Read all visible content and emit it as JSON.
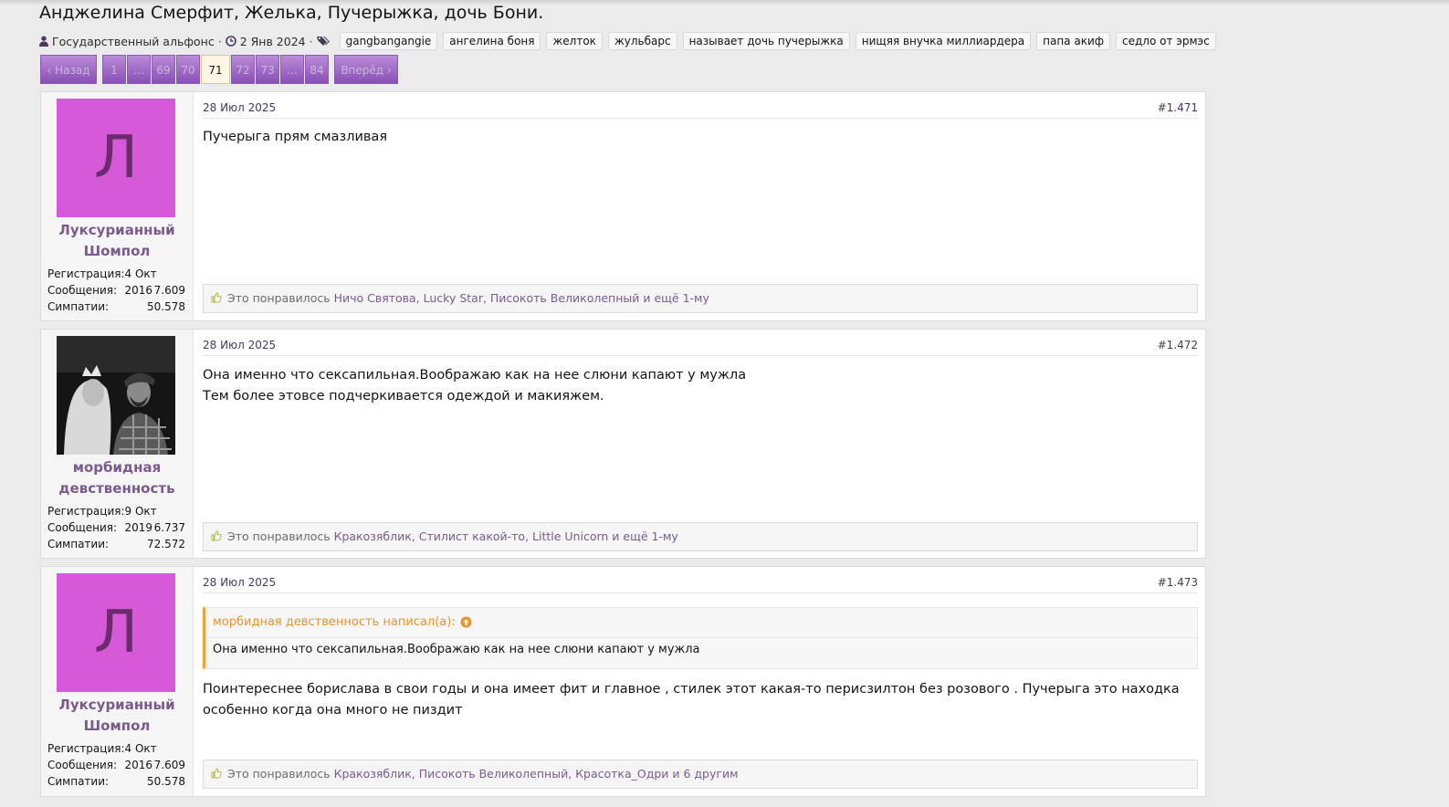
{
  "thread": {
    "title": "Анджелина Смерфит, Желька, Пучерыжка, дочь Бони.",
    "author": "Государственный альфонс",
    "date": "2 Янв 2024",
    "tags": [
      "gangbangangie",
      "ангелина боня",
      "желток",
      "жульбарс",
      "называет дочь пучерыжка",
      "нищяя внучка миллиардера",
      "папа акиф",
      "седло от эрмэс"
    ]
  },
  "pager": {
    "prev": "‹ Назад",
    "pages": [
      "1",
      "…",
      "69",
      "70",
      "71",
      "72",
      "73",
      "…",
      "84"
    ],
    "current": "71",
    "next": "Вперёд ›"
  },
  "stat_labels": {
    "reg": "Регистрация:",
    "msgs": "Сообщения:",
    "likes": "Симпатии:"
  },
  "likes_prefix": "Это понравилось",
  "posts": [
    {
      "avatar_letter": "Л",
      "username": "Луксурианный Шомпол",
      "reg": "4 Окт 2016",
      "msgs": "7.609",
      "likes_count": "50.578",
      "date": "28 Июл 2025",
      "num": "#1.471",
      "text": "Пучерыга прям смазливая",
      "liked_by": "Ничо Святова, Lucky Star, Писокоть Великолепный",
      "liked_more": "и ещё 1-му"
    },
    {
      "avatar_letter": "",
      "username": "морбидная девственность",
      "reg": "9 Окт 2019",
      "msgs": "6.737",
      "likes_count": "72.572",
      "date": "28 Июл 2025",
      "num": "#1.472",
      "text_line1": "Она именно что сексапильная.Воображаю как на нее слюни капают у мужла",
      "text_line2": "Тем более этовсе подчеркивается одеждой и макияжем.",
      "liked_by": "Кракозяблик, Стилист какой-то, Little Unicorn",
      "liked_more": "и ещё 1-му"
    },
    {
      "avatar_letter": "Л",
      "username": "Луксурианный Шомпол",
      "reg": "4 Окт 2016",
      "msgs": "7.609",
      "likes_count": "50.578",
      "date": "28 Июл 2025",
      "num": "#1.473",
      "quote_author": "морбидная девственность написал(а):",
      "quote_text": "Она именно что сексапильная.Воображаю как на нее слюни капают у мужла",
      "text_line1": "Поинтереснее борислава в свои годы и она имеет фит и главное , стилек этот какая-то перисзилтон без розового . Пучерыга это находка",
      "text_line2": "особенно когда она много не пиздит",
      "liked_by": "Кракозяблик, Писокоть Великолепный, Красотка_Одри",
      "liked_more": "и 6 другим"
    }
  ],
  "colors": {
    "accent": "#7b5a8d",
    "pager": "#9a62c4",
    "avatar_bg": "#d65ad8",
    "quote_bar": "#f0a13a"
  },
  "icons": {
    "user": "user-icon",
    "clock": "clock-icon",
    "tags": "tags-icon",
    "like": "thumbs-up-icon",
    "quote_up": "arrow-up-circle-icon"
  }
}
